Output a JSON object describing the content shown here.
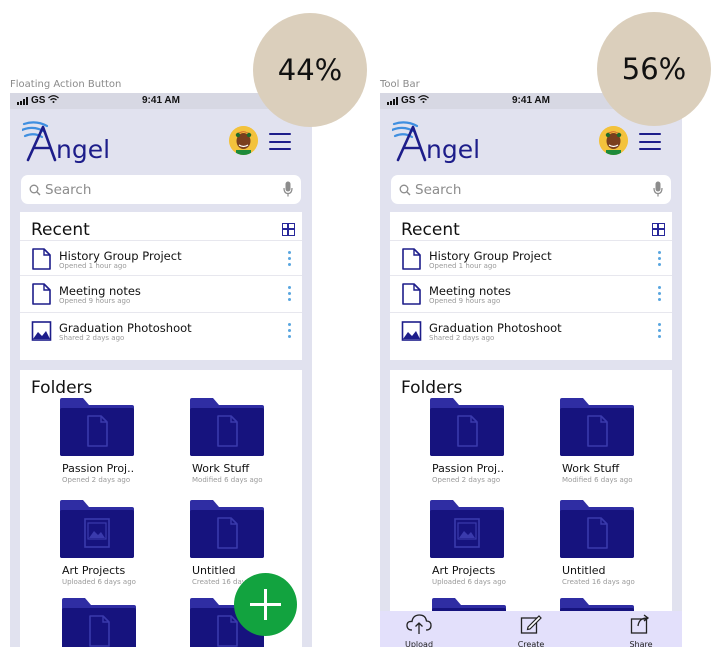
{
  "variants": [
    {
      "caption": "Floating Action Button",
      "percentage": "44%",
      "ui_variant": "fab",
      "status_bar": {
        "carrier": "GS",
        "time": "9:41 AM"
      },
      "app": {
        "logo_text": "Angel"
      },
      "search": {
        "placeholder": "Search"
      },
      "recent": {
        "title": "Recent",
        "items": [
          {
            "title": "History Group Project",
            "subtitle": "Opened 1 hour ago",
            "icon": "document-icon"
          },
          {
            "title": "Meeting notes",
            "subtitle": "Opened 9 hours ago",
            "icon": "document-icon"
          },
          {
            "title": "Graduation Photoshoot",
            "subtitle": "Shared 2 days ago",
            "icon": "image-icon"
          }
        ]
      },
      "folders": {
        "title": "Folders",
        "items": [
          {
            "name": "Passion Proj..",
            "subtitle": "Opened 2 days ago",
            "icon": "document-folder-icon"
          },
          {
            "name": "Work Stuff",
            "subtitle": "Modified 6 days ago",
            "icon": "document-folder-icon"
          },
          {
            "name": "Art Projects",
            "subtitle": "Uploaded 6 days ago",
            "icon": "image-folder-icon"
          },
          {
            "name": "Untitled",
            "subtitle": "Created 16 days ago",
            "icon": "document-folder-icon"
          }
        ]
      }
    },
    {
      "caption": "Tool Bar",
      "percentage": "56%",
      "ui_variant": "toolbar",
      "status_bar": {
        "carrier": "GS",
        "time": "9:41 AM"
      },
      "app": {
        "logo_text": "Angel"
      },
      "search": {
        "placeholder": "Search"
      },
      "recent": {
        "title": "Recent",
        "items": [
          {
            "title": "History Group Project",
            "subtitle": "Opened 1 hour ago",
            "icon": "document-icon"
          },
          {
            "title": "Meeting notes",
            "subtitle": "Opened 9 hours ago",
            "icon": "document-icon"
          },
          {
            "title": "Graduation Photoshoot",
            "subtitle": "Shared 2 days ago",
            "icon": "image-icon"
          }
        ]
      },
      "folders": {
        "title": "Folders",
        "items": [
          {
            "name": "Passion Proj..",
            "subtitle": "Opened 2 days ago",
            "icon": "document-folder-icon"
          },
          {
            "name": "Work Stuff",
            "subtitle": "Modified 6 days ago",
            "icon": "document-folder-icon"
          },
          {
            "name": "Art Projects",
            "subtitle": "Uploaded 6 days ago",
            "icon": "image-folder-icon"
          },
          {
            "name": "Untitled",
            "subtitle": "Created 16 days ago",
            "icon": "document-folder-icon"
          }
        ]
      },
      "toolbar": {
        "items": [
          {
            "label": "Upload",
            "icon": "cloud-upload-icon"
          },
          {
            "label": "Create",
            "icon": "create-icon"
          },
          {
            "label": "Share",
            "icon": "share-icon"
          }
        ]
      }
    }
  ],
  "colors": {
    "brand": "#1d1d8a",
    "folder": "#16137e",
    "folder_tab": "#2f2da3",
    "fab": "#12a33f",
    "toolbar": "#e3e0fb",
    "phone_bg": "#e1e2ef",
    "bubble": "#dbcfbc",
    "menu_dots": "#5aa6e0"
  }
}
